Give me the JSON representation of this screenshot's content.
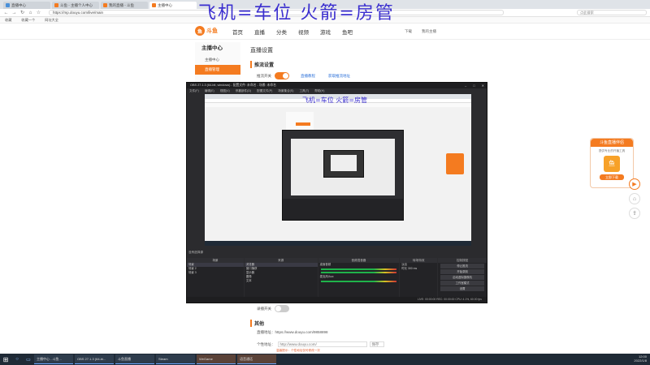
{
  "browser": {
    "tabs": [
      {
        "label": "直播中心"
      },
      {
        "label": "斗鱼 - 主播个人中心"
      },
      {
        "label": "我的直播 - 斗鱼"
      },
      {
        "label": "主播中心"
      }
    ],
    "url": "https://mp.douyu.com/live/main",
    "search_placeholder": "点此搜索",
    "bookmarks": [
      "收藏",
      "收藏一个",
      "网址大全"
    ]
  },
  "site": {
    "logo_text": "斗鱼",
    "banner_text": "飞机=车位 火箭=房管",
    "nav": [
      "首页",
      "直播",
      "分类",
      "视频",
      "游戏",
      "鱼吧"
    ],
    "header_right": [
      "下载",
      "我的主播"
    ]
  },
  "menu": {
    "title": "主播中心",
    "items": [
      "主播中心",
      "直播管理"
    ]
  },
  "content": {
    "title": "直播设置",
    "section": "推流设置",
    "row1_label": "推流开关",
    "row1_link1": "直播教程",
    "row1_link2": "获取推流地址",
    "row_lower_label": "录播开关",
    "more_title": "其他",
    "addr1": "直播地址：https://www.douyu.com/9858898",
    "addr2_label": "个性地址：",
    "addr2_value": "http://www.douyu.com/",
    "addr2_select": "保存",
    "tip": "温馨提示：个性地址仅可修改一次"
  },
  "promo": {
    "header": "斗鱼直播伴侣",
    "sub": "提供专业的开播工具",
    "button": "立即下载"
  },
  "obs": {
    "title": "OBS 27.1.3 (64-bit, windows) - 配置文件: 未命名 - 场景: 未命名",
    "menu": [
      "文件(F)",
      "编辑(E)",
      "视图(V)",
      "停靠部件(D)",
      "配置文件(P)",
      "场景集合(S)",
      "工具(T)",
      "帮助(H)"
    ],
    "inner_banner": "飞机=车位 火箭=房管",
    "scene_label": "没有选择源",
    "docks": {
      "scenes_header": "场景",
      "scenes": [
        "场景",
        "场景 2",
        "场景 3"
      ],
      "sources_header": "来源",
      "sources": [
        "浏览器",
        "窗口捕获",
        "显示器",
        "图像",
        "文本"
      ],
      "mixer_header": "音频混音器",
      "mixer_items": [
        "桌面音频",
        "麦克风/Aux"
      ],
      "transition_header": "转场特效",
      "transition_items": [
        "淡出",
        "时长 300 ms"
      ],
      "controls_header": "控制按钮",
      "controls": [
        "停止推流",
        "开始录制",
        "启动虚拟摄像机",
        "工作室模式",
        "设置",
        "退出"
      ]
    },
    "status": "LIVE: 00:00:00  REC: 00:00:00  CPU: 4.1%, 60.00 fps"
  },
  "taskbar": {
    "apps": [
      "主播中心 - 斗鱼...",
      "OBS 27.1.3 (64-bi...",
      "斗鱼直播",
      "Steam",
      "WeGame",
      "语音通话"
    ],
    "time": "12:00",
    "date": "2022/1/8"
  }
}
